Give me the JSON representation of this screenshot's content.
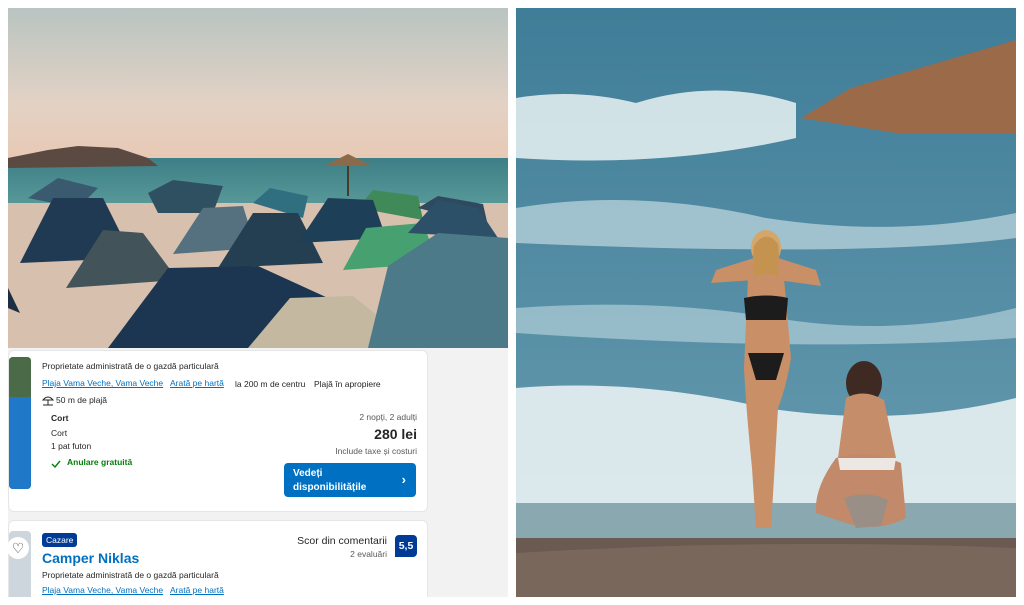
{
  "listing1": {
    "host_note": "Proprietate administrată de o gazdă particulară",
    "location_link": "Plaja Vama Veche, Vama Veche",
    "map_link": "Arată pe hartă",
    "distance": "la 200 m de centru",
    "beach": "Plajă în apropiere",
    "beach_distance": "50 m de plajă",
    "room_title": "Cort",
    "room_type": "Cort",
    "bed": "1 pat futon",
    "cancellation": "Anulare gratuită",
    "stay_info": "2 nopți, 2 adulți",
    "price": "280 lei",
    "taxes": "Include taxe și costuri",
    "cta_line1": "Vedeți",
    "cta_line2": "disponibilitățile",
    "cta_arrow": "›"
  },
  "listing2": {
    "badge": "Cazare",
    "name": "Camper Niklas",
    "score_label": "Scor din comentarii",
    "reviews": "2 evaluări",
    "score": "5,5",
    "host_note": "Proprietate administrată de o gazdă particulară",
    "location_link": "Plaja Vama Veche, Vama Veche",
    "map_link": "Arată pe hartă",
    "heart": "♡"
  },
  "icons": {
    "beach": "umbrella-icon",
    "check": "checkmark-icon",
    "favorite": "heart-icon"
  },
  "colors": {
    "link": "#0071c2",
    "score": "#003b95",
    "check": "#008009",
    "button": "#0071c2"
  }
}
